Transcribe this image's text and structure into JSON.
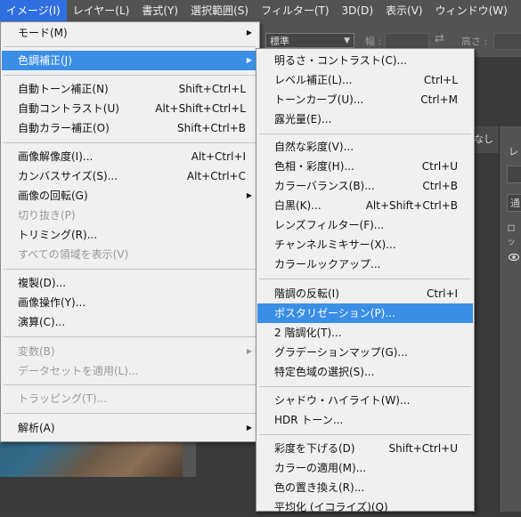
{
  "menubar": {
    "items": [
      {
        "label": "イメージ(I)"
      },
      {
        "label": "レイヤー(L)"
      },
      {
        "label": "書式(Y)"
      },
      {
        "label": "選択範囲(S)"
      },
      {
        "label": "フィルター(T)"
      },
      {
        "label": "3D(D)"
      },
      {
        "label": "表示(V)"
      },
      {
        "label": "ウィンドウ(W)"
      }
    ]
  },
  "options_bar": {
    "style_value": "標準",
    "width_label": "幅 :",
    "height_label": "高さ :"
  },
  "background": {
    "doc_tab_label": "なし",
    "layers_title": "レ",
    "layers_field_text": "通",
    "layers_lock_text": "ロッ"
  },
  "image_menu": {
    "items": [
      {
        "label": "モード(M)",
        "submenu": true
      },
      {
        "label": "色調補正(J)",
        "submenu": true,
        "highlighted": true
      },
      {
        "label": "自動トーン補正(N)",
        "shortcut": "Shift+Ctrl+L"
      },
      {
        "label": "自動コントラスト(U)",
        "shortcut": "Alt+Shift+Ctrl+L"
      },
      {
        "label": "自動カラー補正(O)",
        "shortcut": "Shift+Ctrl+B"
      },
      {
        "label": "画像解像度(I)...",
        "shortcut": "Alt+Ctrl+I"
      },
      {
        "label": "カンバスサイズ(S)...",
        "shortcut": "Alt+Ctrl+C"
      },
      {
        "label": "画像の回転(G)",
        "submenu": true
      },
      {
        "label": "切り抜き(P)",
        "disabled": true
      },
      {
        "label": "トリミング(R)..."
      },
      {
        "label": "すべての領域を表示(V)",
        "disabled": true
      },
      {
        "label": "複製(D)..."
      },
      {
        "label": "画像操作(Y)..."
      },
      {
        "label": "演算(C)..."
      },
      {
        "label": "変数(B)",
        "submenu": true,
        "disabled": true
      },
      {
        "label": "データセットを適用(L)...",
        "disabled": true
      },
      {
        "label": "トラッピング(T)...",
        "disabled": true
      },
      {
        "label": "解析(A)",
        "submenu": true
      }
    ]
  },
  "adjustments_submenu": {
    "items": [
      {
        "label": "明るさ・コントラスト(C)..."
      },
      {
        "label": "レベル補正(L)...",
        "shortcut": "Ctrl+L"
      },
      {
        "label": "トーンカーブ(U)...",
        "shortcut": "Ctrl+M"
      },
      {
        "label": "露光量(E)..."
      },
      {
        "label": "自然な彩度(V)..."
      },
      {
        "label": "色相・彩度(H)...",
        "shortcut": "Ctrl+U"
      },
      {
        "label": "カラーバランス(B)...",
        "shortcut": "Ctrl+B"
      },
      {
        "label": "白黒(K)...",
        "shortcut": "Alt+Shift+Ctrl+B"
      },
      {
        "label": "レンズフィルター(F)..."
      },
      {
        "label": "チャンネルミキサー(X)..."
      },
      {
        "label": "カラールックアップ..."
      },
      {
        "label": "階調の反転(I)",
        "shortcut": "Ctrl+I"
      },
      {
        "label": "ポスタリゼーション(P)...",
        "highlighted": true
      },
      {
        "label": "2 階調化(T)..."
      },
      {
        "label": "グラデーションマップ(G)..."
      },
      {
        "label": "特定色域の選択(S)..."
      },
      {
        "label": "シャドウ・ハイライト(W)..."
      },
      {
        "label": "HDR トーン..."
      },
      {
        "label": "彩度を下げる(D)",
        "shortcut": "Shift+Ctrl+U"
      },
      {
        "label": "カラーの適用(M)..."
      },
      {
        "label": "色の置き換え(R)..."
      },
      {
        "label": "平均化 (イコライズ)(Q)"
      }
    ]
  },
  "colors": {
    "menu_highlight": "#3a8ee6",
    "menubar_active": "#2f6fe0",
    "menu_bg": "#f0f0f0",
    "app_chrome": "#535353"
  }
}
